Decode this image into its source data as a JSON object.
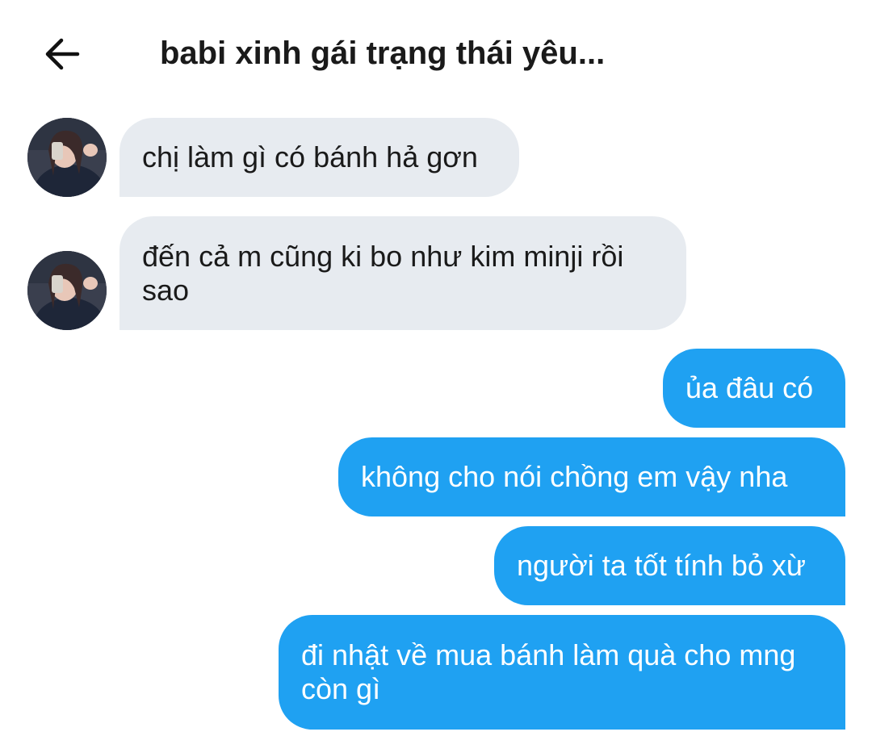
{
  "header": {
    "title": "babi xinh gái trạng thái yêu..."
  },
  "messages": [
    {
      "direction": "in",
      "text": "chị làm gì có bánh hả gơn"
    },
    {
      "direction": "in",
      "text": "đến cả m cũng ki bo như kim minji rồi sao"
    },
    {
      "direction": "out",
      "text": "ủa đâu có"
    },
    {
      "direction": "out",
      "text": "không cho nói chồng em vậy nha"
    },
    {
      "direction": "out",
      "text": "người ta tốt tính bỏ xừ"
    },
    {
      "direction": "out",
      "text": "đi nhật về mua bánh làm quà cho mng còn gì"
    }
  ],
  "colors": {
    "incoming_bubble": "#e7ebf0",
    "outgoing_bubble": "#1fa1f2"
  }
}
